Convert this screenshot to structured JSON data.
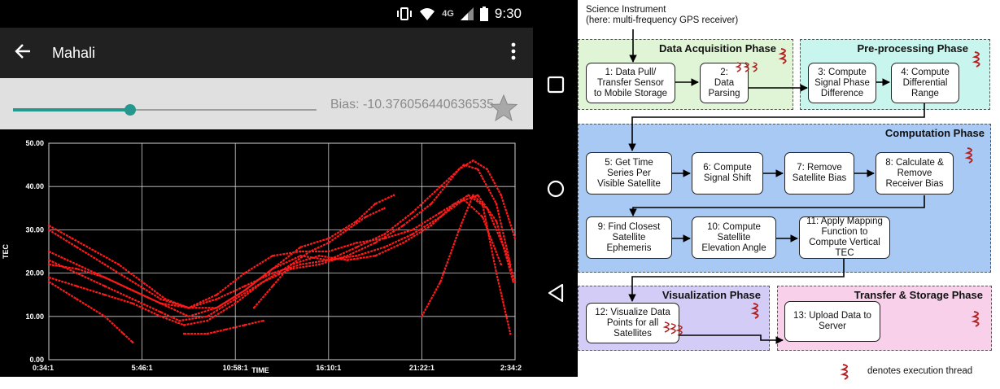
{
  "status_bar": {
    "network": "4G",
    "time": "9:30"
  },
  "app": {
    "title": "Mahali"
  },
  "controls": {
    "slider_value_fraction": 0.386,
    "bias_text": "Bias: -10.376056440636535"
  },
  "colors": {
    "teal": "#26978c",
    "trace": "#ff1a1a",
    "acq": "#dff5d5",
    "pre": "#c8f5ee",
    "comp": "#a9c9f5",
    "vis": "#d3ccf7",
    "transfer": "#f8d0ea",
    "thread": "#b22222"
  },
  "chart_data": {
    "type": "scatter",
    "ylabel": "TEC",
    "xlabel": "TIME",
    "ylim": [
      0,
      50
    ],
    "y_ticks": [
      "0.00",
      "10.00",
      "20.00",
      "30.00",
      "40.00",
      "50.00"
    ],
    "x_ticks": [
      "0:34:1",
      "5:46:1",
      "10:58:1",
      "16:10:1",
      "21:22:1",
      "2:34:2"
    ],
    "grid": true,
    "x_domain": [
      0,
      5
    ],
    "series": [
      {
        "values": [
          [
            0,
            23
          ],
          [
            0.3,
            20
          ],
          [
            0.6,
            17
          ],
          [
            0.9,
            14
          ],
          [
            1.2,
            11
          ],
          [
            1.4,
            9
          ],
          [
            1.7,
            10
          ],
          [
            2,
            14
          ],
          [
            2.3,
            18
          ],
          [
            2.6,
            21
          ],
          [
            2.9,
            22
          ],
          [
            3.2,
            24
          ],
          [
            3.5,
            27
          ],
          [
            3.8,
            31
          ],
          [
            4.1,
            36
          ],
          [
            4.4,
            44
          ],
          [
            4.55,
            46
          ],
          [
            4.7,
            44
          ],
          [
            4.85,
            38
          ],
          [
            5,
            28
          ]
        ]
      },
      {
        "values": [
          [
            0,
            25
          ],
          [
            0.3,
            22
          ],
          [
            0.6,
            19
          ],
          [
            0.9,
            16
          ],
          [
            1.2,
            13
          ],
          [
            1.5,
            12
          ],
          [
            1.8,
            14
          ],
          [
            2.1,
            17
          ],
          [
            2.4,
            20
          ],
          [
            2.7,
            22
          ],
          [
            3,
            23
          ],
          [
            3.3,
            26
          ],
          [
            3.6,
            29
          ],
          [
            3.9,
            34
          ],
          [
            4.2,
            40
          ],
          [
            4.45,
            45
          ],
          [
            4.6,
            44
          ],
          [
            4.8,
            36
          ],
          [
            4.95,
            22
          ]
        ]
      },
      {
        "values": [
          [
            0,
            30
          ],
          [
            0.3,
            26
          ],
          [
            0.6,
            22
          ],
          [
            0.9,
            18
          ],
          [
            1.2,
            14
          ],
          [
            1.5,
            12
          ],
          [
            1.8,
            15
          ],
          [
            2.1,
            20
          ],
          [
            2.4,
            24
          ],
          [
            2.7,
            25
          ],
          [
            3,
            25
          ],
          [
            3.3,
            27
          ],
          [
            3.6,
            28
          ],
          [
            3.9,
            30
          ],
          [
            4.2,
            34
          ],
          [
            4.5,
            38
          ],
          [
            4.7,
            35
          ],
          [
            4.9,
            25
          ],
          [
            5,
            18
          ]
        ]
      },
      {
        "values": [
          [
            0,
            31
          ],
          [
            0.25,
            28
          ],
          [
            0.5,
            25
          ],
          [
            0.75,
            22
          ],
          [
            1,
            18
          ],
          [
            1.25,
            14
          ],
          [
            1.5,
            12
          ],
          [
            1.8,
            12
          ],
          [
            2.1,
            16
          ],
          [
            2.4,
            21
          ],
          [
            2.7,
            24
          ],
          [
            3,
            23
          ],
          [
            3.3,
            24
          ],
          [
            3.6,
            26
          ],
          [
            3.9,
            29
          ],
          [
            4.2,
            33
          ],
          [
            4.45,
            37
          ],
          [
            4.65,
            33
          ],
          [
            4.85,
            22
          ]
        ]
      },
      {
        "values": [
          [
            0,
            19
          ],
          [
            0.3,
            17
          ],
          [
            0.6,
            15
          ],
          [
            0.9,
            13
          ],
          [
            1.2,
            10
          ],
          [
            1.45,
            8
          ],
          [
            1.7,
            9
          ],
          [
            2,
            13
          ],
          [
            2.3,
            18
          ],
          [
            2.6,
            22
          ],
          [
            2.9,
            24
          ],
          [
            3.2,
            23
          ],
          [
            3.5,
            24
          ],
          [
            3.8,
            27
          ],
          [
            4.1,
            31
          ],
          [
            4.35,
            36
          ],
          [
            4.6,
            38
          ],
          [
            4.8,
            32
          ],
          [
            4.98,
            18
          ]
        ]
      },
      {
        "values": [
          [
            0,
            22
          ],
          [
            0.3,
            21
          ],
          [
            0.6,
            19
          ],
          [
            0.9,
            16
          ],
          [
            1.2,
            13
          ],
          [
            1.5,
            10
          ],
          [
            1.8,
            12
          ],
          [
            2.1,
            16
          ],
          [
            2.4,
            21
          ],
          [
            2.7,
            26
          ],
          [
            3,
            28
          ],
          [
            3.3,
            32
          ],
          [
            3.5,
            36
          ],
          [
            3.7,
            38
          ]
        ]
      },
      {
        "values": [
          [
            0,
            18
          ],
          [
            0.3,
            14
          ],
          [
            0.6,
            10
          ],
          [
            0.8,
            6
          ],
          [
            0.9,
            4
          ]
        ]
      },
      {
        "values": [
          [
            1.45,
            6
          ],
          [
            1.7,
            6
          ],
          [
            1.9,
            7
          ],
          [
            2.1,
            8
          ],
          [
            2.3,
            9
          ]
        ]
      },
      {
        "values": [
          [
            4,
            10
          ],
          [
            4.2,
            18
          ],
          [
            4.4,
            30
          ],
          [
            4.55,
            38
          ],
          [
            4.65,
            36
          ],
          [
            4.8,
            20
          ],
          [
            4.95,
            6
          ]
        ]
      },
      {
        "values": [
          [
            2.2,
            12
          ],
          [
            2.4,
            17
          ],
          [
            2.6,
            22
          ],
          [
            2.8,
            25
          ],
          [
            3,
            27
          ],
          [
            3.2,
            30
          ],
          [
            3.4,
            33
          ],
          [
            3.6,
            35
          ]
        ]
      }
    ]
  },
  "diagram": {
    "source": [
      "Science Instrument",
      "(here: multi-frequency GPS receiver)"
    ],
    "phases": {
      "acquisition": "Data Acquisition Phase",
      "preprocessing": "Pre-processing Phase",
      "computation": "Computation Phase",
      "visualization": "Visualization Phase",
      "transfer": "Transfer & Storage Phase"
    },
    "steps": {
      "s1": [
        "1: Data Pull/",
        "Transfer Sensor",
        "to Mobile Storage"
      ],
      "s2": [
        "2:",
        "Data",
        "Parsing"
      ],
      "s3": [
        "3: Compute",
        "Signal Phase",
        "Difference"
      ],
      "s4": [
        "4: Compute",
        "Differential",
        "Range"
      ],
      "s5": [
        "5: Get Time",
        "Series Per",
        "Visible Satellite"
      ],
      "s6": [
        "6: Compute",
        "Signal Shift"
      ],
      "s7": [
        "7: Remove",
        "Satellite Bias"
      ],
      "s8": [
        "8: Calculate &",
        "Remove",
        "Receiver Bias"
      ],
      "s9": [
        "9: Find Closest",
        "Satellite",
        "Ephemeris"
      ],
      "s10": [
        "10: Compute",
        "Satellite",
        "Elevation Angle"
      ],
      "s11": [
        "11: Apply Mapping",
        "Function to",
        "Compute Vertical",
        "TEC"
      ],
      "s12": [
        "12: Visualize Data",
        "Points for all",
        "Satellites"
      ],
      "s13": [
        "13: Upload Data to",
        "Server"
      ]
    },
    "legend": "denotes execution thread"
  }
}
